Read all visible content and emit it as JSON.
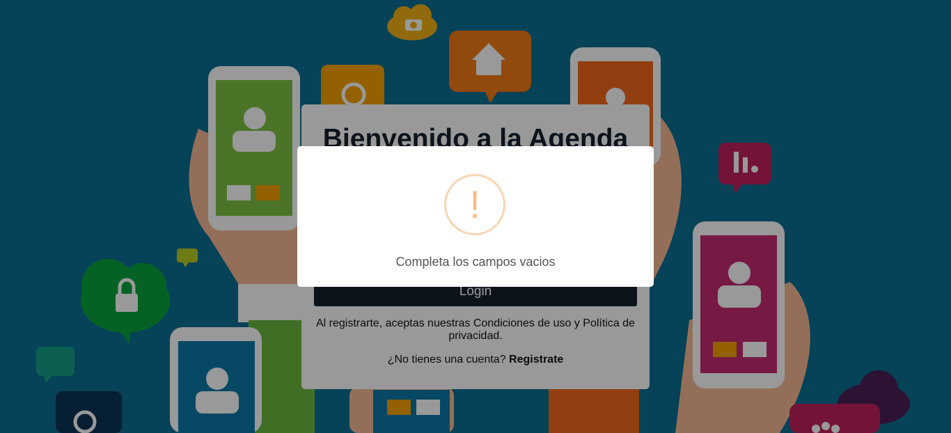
{
  "login_card": {
    "title": "Bienvenido a la Agenda",
    "login_button": "Login",
    "terms": "Al registrarte, aceptas nuestras Condiciones de uso y Política de privacidad.",
    "no_account": "¿No tienes una cuenta?",
    "register_link": "Registrate"
  },
  "alert": {
    "icon": "warning-icon",
    "symbol": "!",
    "message": "Completa los campos vacios"
  },
  "colors": {
    "background": "#0a6f93",
    "dark": "#16202e",
    "warning_stroke": "#f8d5b2",
    "warning_glyph": "#f8bb86"
  }
}
